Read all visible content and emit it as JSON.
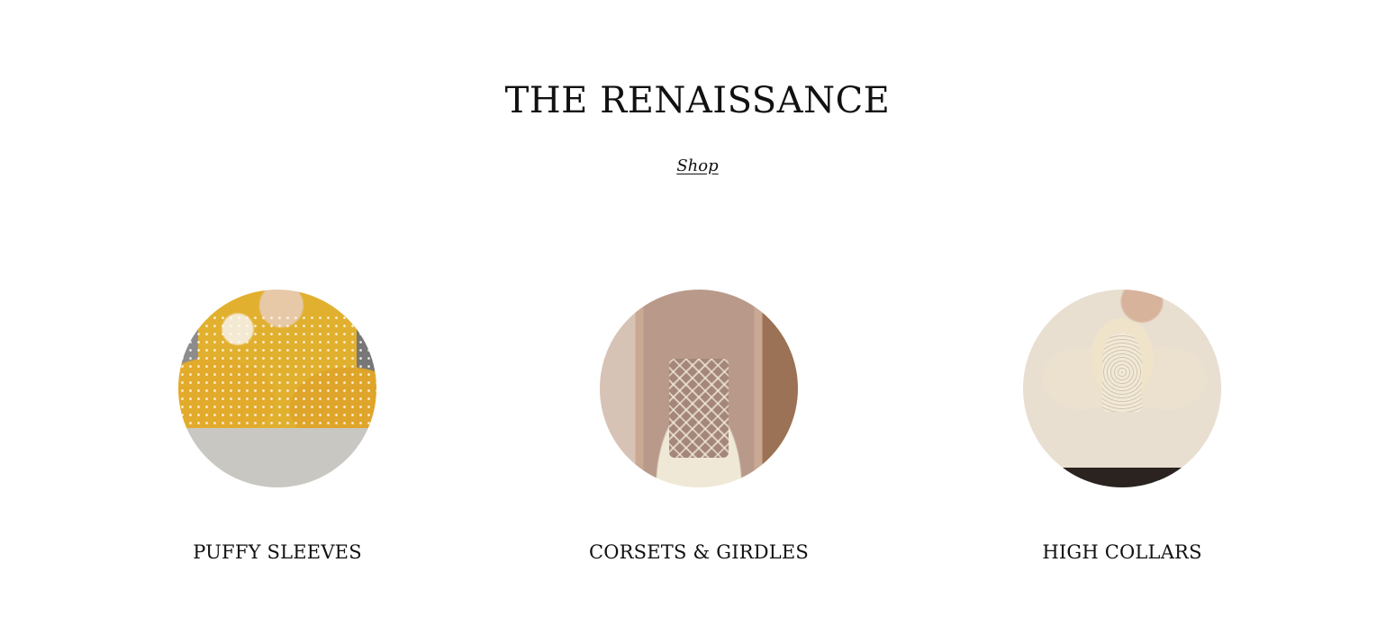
{
  "header": {
    "title": "THE RENAISSANCE",
    "shop_link": "Shop"
  },
  "categories": [
    {
      "label": "PUFFY SLEEVES"
    },
    {
      "label": "CORSETS & GIRDLES"
    },
    {
      "label": "HIGH COLLARS"
    }
  ]
}
